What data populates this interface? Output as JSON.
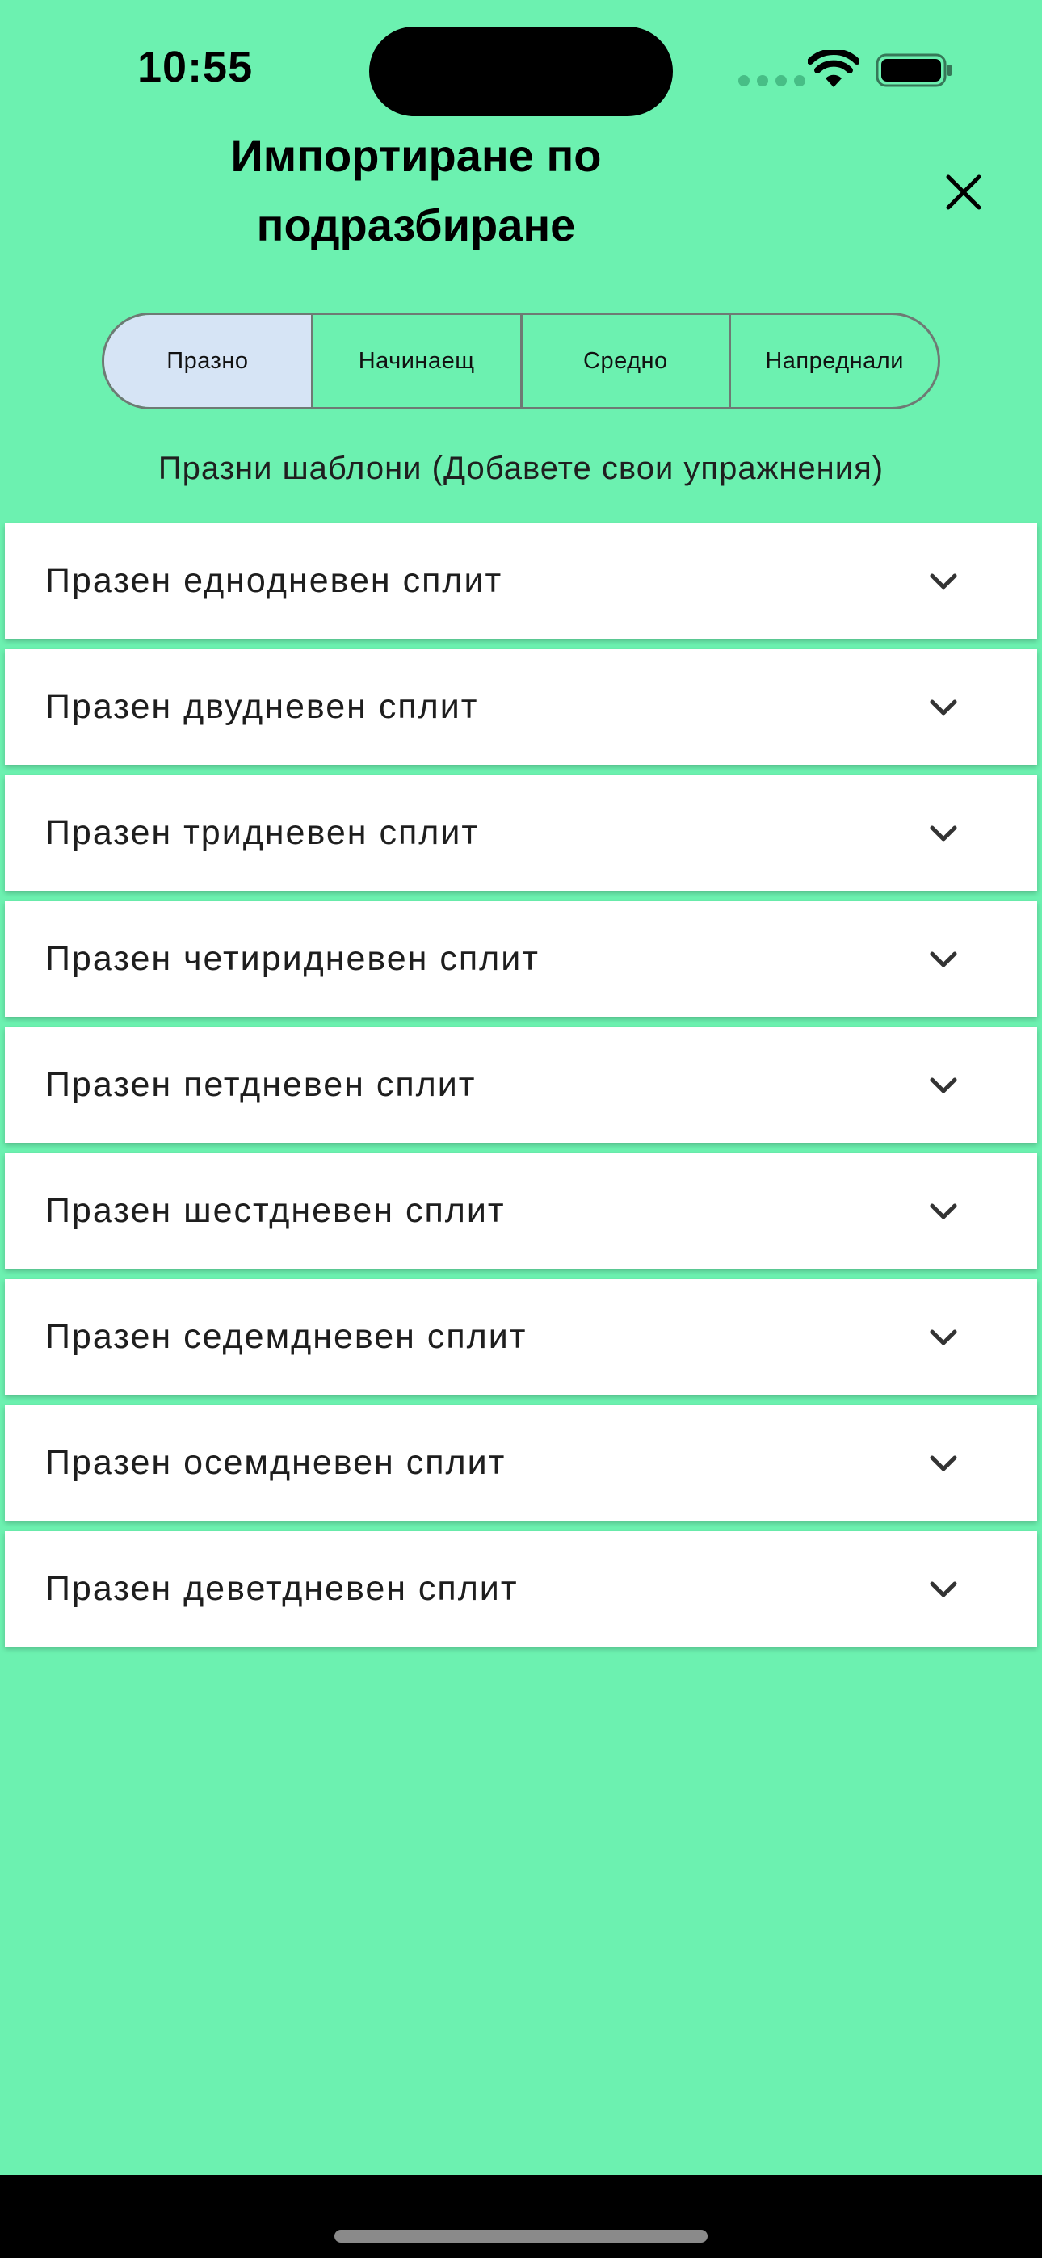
{
  "status_bar": {
    "time": "10:55"
  },
  "header": {
    "title": "Импортиране по подразбиране",
    "close_icon": "close-icon"
  },
  "segments": [
    {
      "label": "Празно",
      "selected": true
    },
    {
      "label": "Начинаещ",
      "selected": false
    },
    {
      "label": "Средно",
      "selected": false
    },
    {
      "label": "Напреднали",
      "selected": false
    }
  ],
  "section_label": "Празни шаблони (Добавете свои упражнения)",
  "templates": [
    {
      "label": "Празен еднодневен сплит"
    },
    {
      "label": "Празен двудневен сплит"
    },
    {
      "label": "Празен тридневен сплит"
    },
    {
      "label": "Празен четиридневен сплит"
    },
    {
      "label": "Празен петдневен сплит"
    },
    {
      "label": "Празен шестдневен сплит"
    },
    {
      "label": "Празен седемдневен сплит"
    },
    {
      "label": "Празен осемдневен сплит"
    },
    {
      "label": "Празен деветдневен сплит"
    }
  ],
  "colors": {
    "background": "#6cf1b0",
    "selected_segment": "#d6e4f5",
    "card": "#ffffff"
  }
}
